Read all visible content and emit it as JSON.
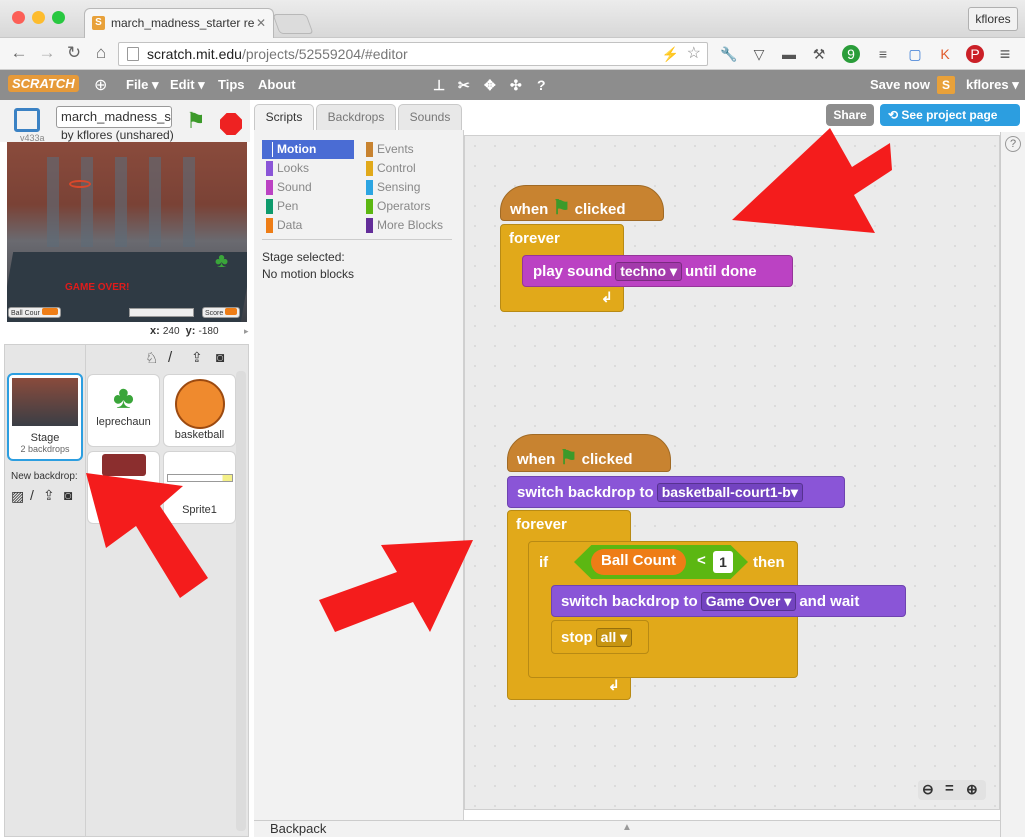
{
  "browser": {
    "tab_title": "march_madness_starter re",
    "url_host": "scratch.mit.edu",
    "url_path": "/projects/52559204/#editor",
    "profile": "kflores"
  },
  "menubar": {
    "logo": "SCRATCH",
    "file": "File ▾",
    "edit": "Edit ▾",
    "tips": "Tips",
    "about": "About",
    "save_now": "Save now",
    "user": "kflores ▾"
  },
  "project": {
    "title": "march_madness_s",
    "author": "by kflores (unshared)",
    "version": "v433a"
  },
  "stage": {
    "game_over": "GAME OVER!",
    "monitor_ball": "Ball Cour",
    "monitor_score": "Score",
    "x_label": "x:",
    "x": "240",
    "y_label": "y:",
    "y": "-180"
  },
  "sprites": {
    "stage_label": "Stage",
    "stage_sub": "2 backdrops",
    "new_backdrop": "New backdrop:",
    "items": [
      "leprechaun",
      "basketball",
      "",
      "Sprite1"
    ]
  },
  "editor": {
    "tabs": [
      "Scripts",
      "Backdrops",
      "Sounds"
    ],
    "share": "Share",
    "see_project": "See project page"
  },
  "palette": {
    "left": [
      "Motion",
      "Looks",
      "Sound",
      "Pen",
      "Data"
    ],
    "right": [
      "Events",
      "Control",
      "Sensing",
      "Operators",
      "More Blocks"
    ],
    "stage_selected": "Stage selected:",
    "no_motion": "No motion blocks"
  },
  "scripts": {
    "when": "when",
    "clicked": "clicked",
    "forever": "forever",
    "play_sound": "play sound",
    "sound_name": "techno",
    "until_done": "until done",
    "switch_backdrop": "switch backdrop to",
    "backdrop1": "basketball-court1-b",
    "if": "if",
    "var": "Ball Count",
    "lt": "<",
    "num": "1",
    "then": "then",
    "backdrop2": "Game Over",
    "and_wait": "and wait",
    "stop": "stop",
    "stop_opt": "all"
  },
  "backpack": "Backpack",
  "colors": {
    "motion": "#4a6cd4",
    "looks": "#8a55d7",
    "sound": "#bb42c3",
    "pen": "#0e9a6c",
    "data": "#ee7d16",
    "events": "#c88330",
    "control": "#e1a91a",
    "sensing": "#2ca5e2",
    "operators": "#5cb712",
    "more": "#632d99"
  }
}
